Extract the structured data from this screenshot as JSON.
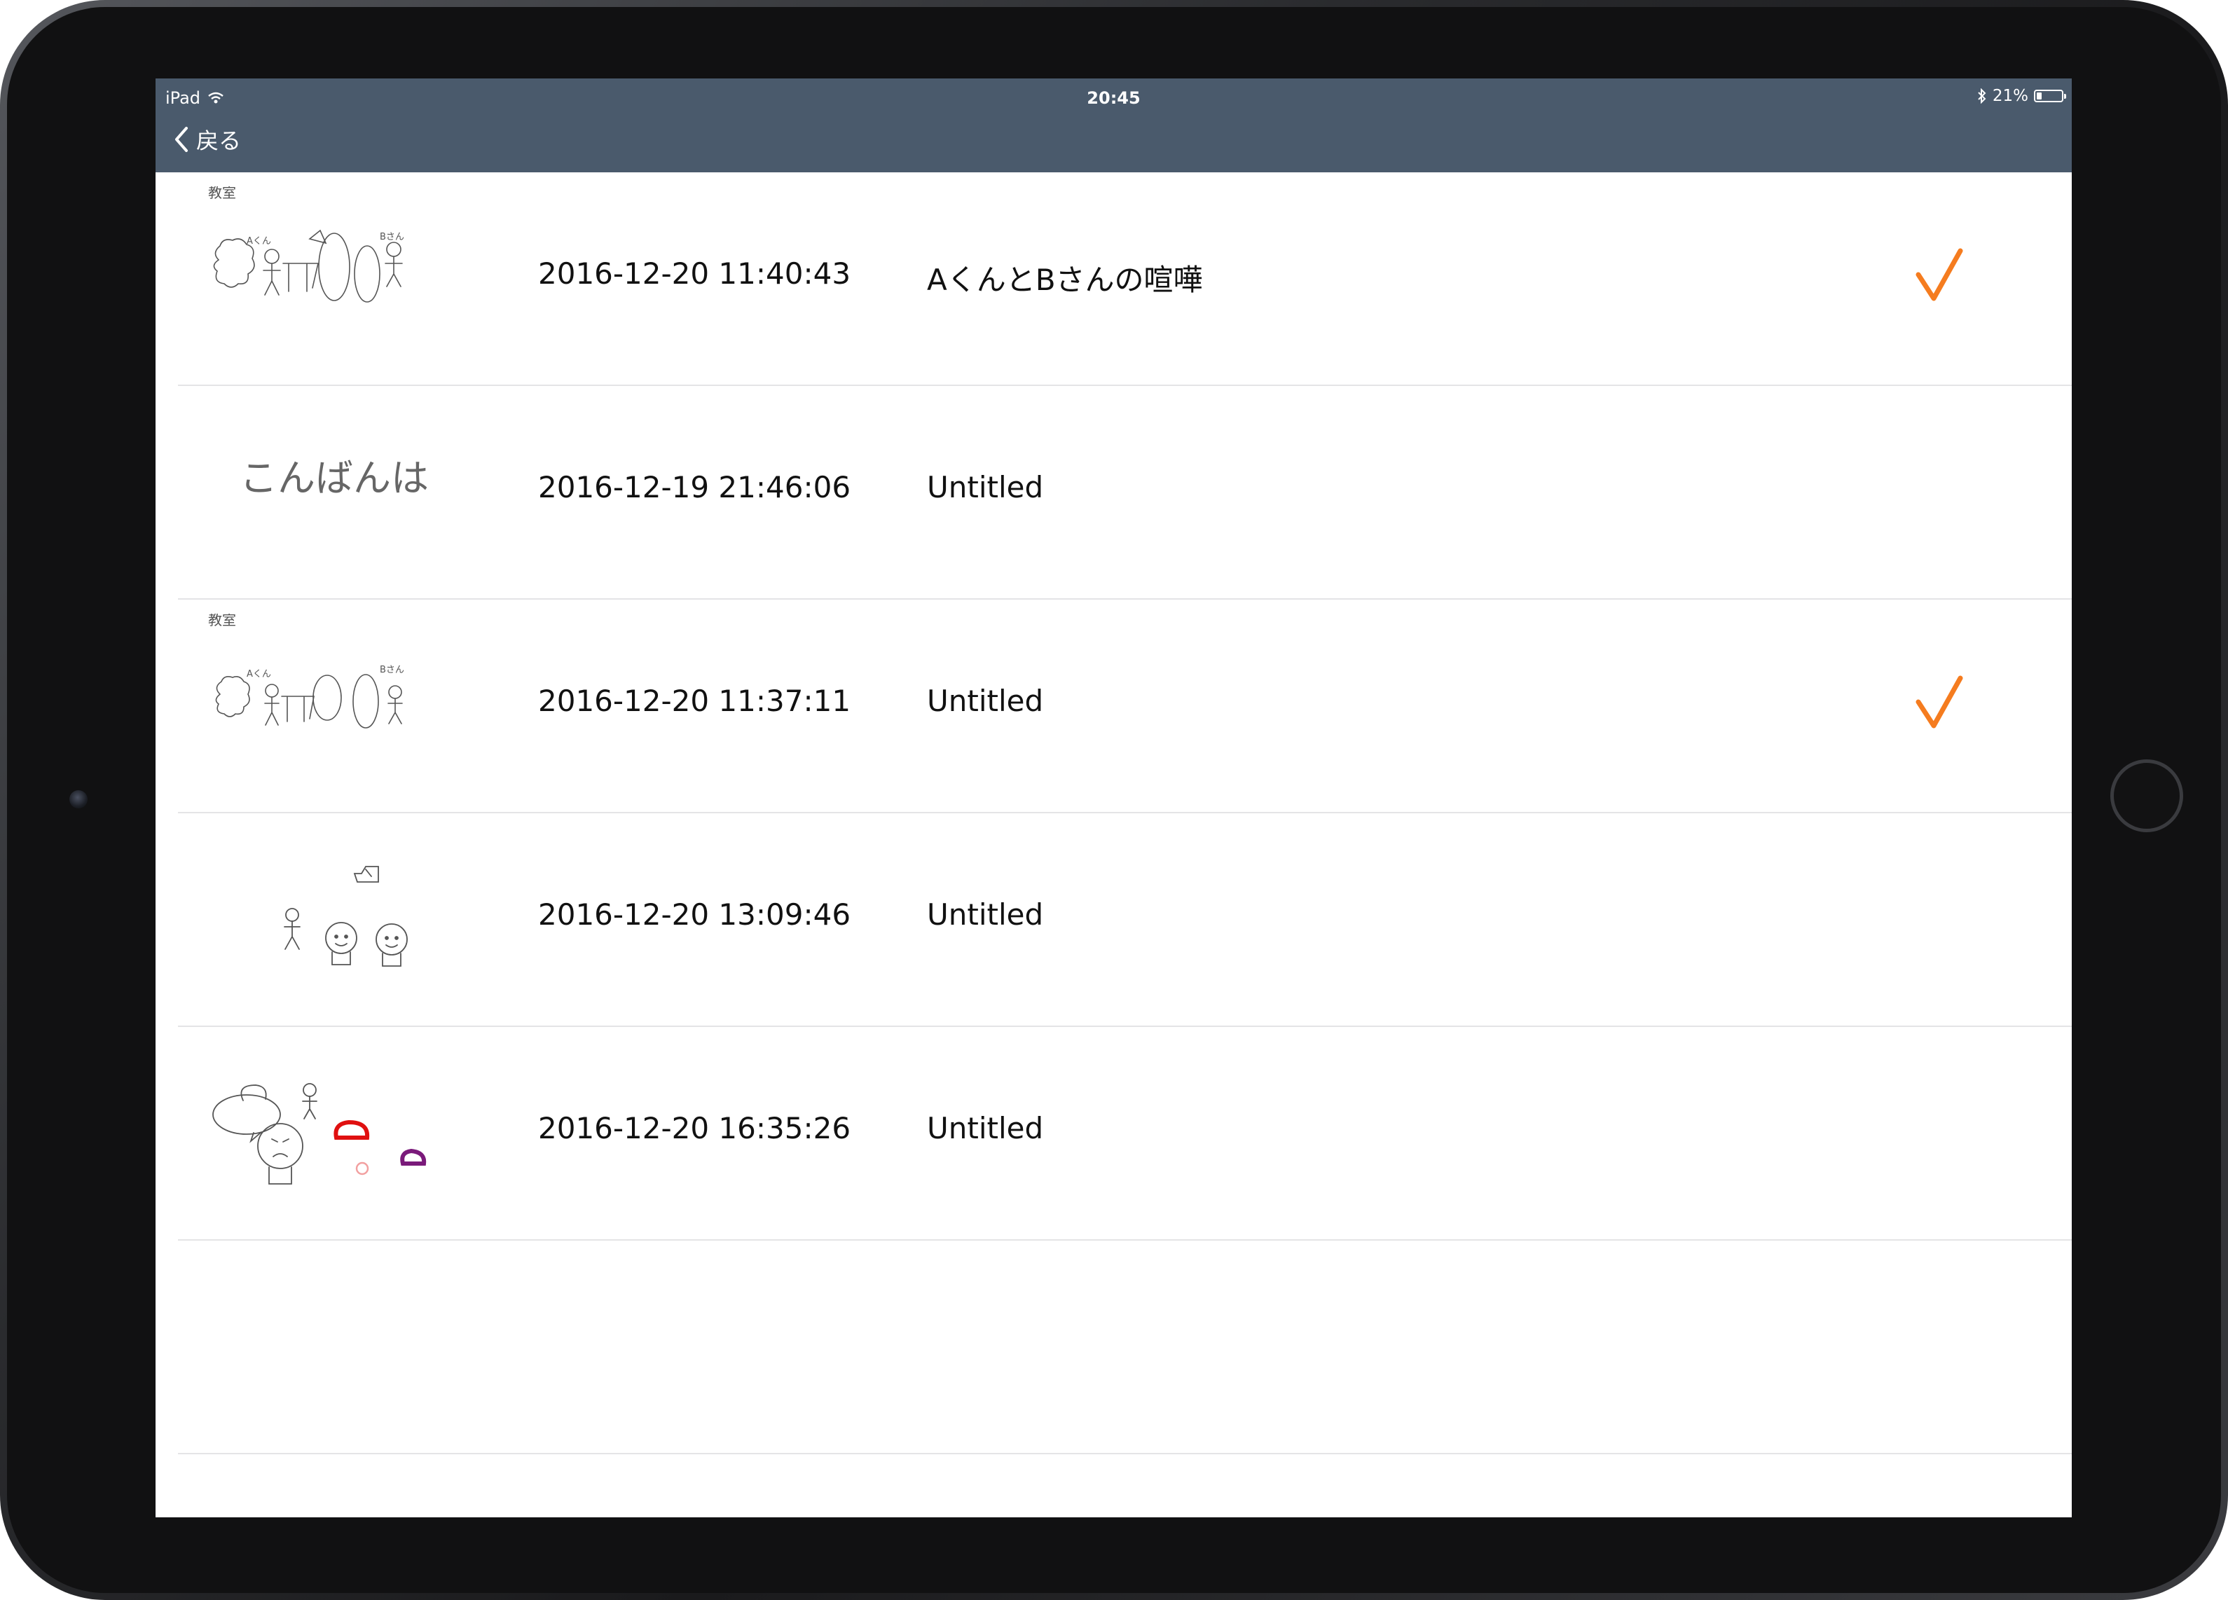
{
  "status_bar": {
    "device": "iPad",
    "time": "20:45",
    "battery": "21%",
    "battery_level": 0.21,
    "icons": [
      "wifi-icon",
      "bluetooth-icon",
      "battery-icon"
    ]
  },
  "nav": {
    "back_label": "戻る"
  },
  "colors": {
    "nav_bar": "#4a5a6c",
    "checkmark": "#f57c1f",
    "separator": "#e4e4e6"
  },
  "drawings": [
    {
      "date": "2016-12-20 11:40:43",
      "title": "AくんとBさんの喧嘩",
      "checked": true,
      "thumb_labels": [
        "教室",
        "Aくん",
        "Bさん"
      ]
    },
    {
      "date": "2016-12-19 21:46:06",
      "title": "Untitled",
      "checked": false,
      "thumb_labels": [
        "こんばんは"
      ]
    },
    {
      "date": "2016-12-20 11:37:11",
      "title": "Untitled",
      "checked": true,
      "thumb_labels": [
        "教室",
        "Aくん",
        "Bさん"
      ]
    },
    {
      "date": "2016-12-20 13:09:46",
      "title": "Untitled",
      "checked": false,
      "thumb_labels": []
    },
    {
      "date": "2016-12-20 16:35:26",
      "title": "Untitled",
      "checked": false,
      "thumb_labels": []
    }
  ]
}
